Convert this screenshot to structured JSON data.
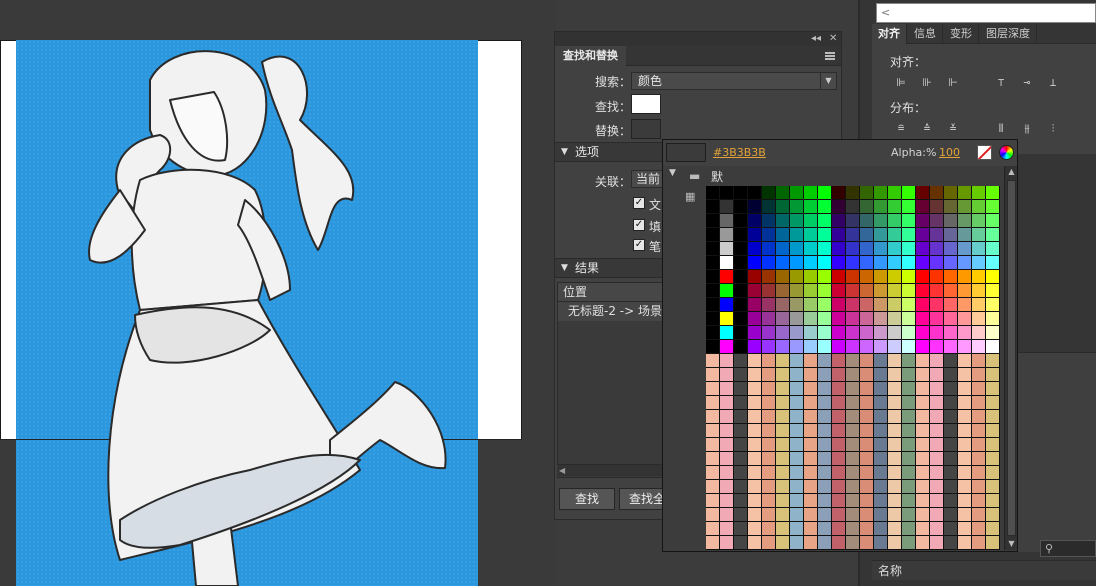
{
  "find_panel": {
    "collapse_glyph": "◂◂",
    "close_glyph": "✕",
    "title": "查找和替换",
    "search_label": "搜索：",
    "search_value": "颜色",
    "find_label": "查找：",
    "replace_label": "替换：",
    "find_color": "#FFFFFF",
    "replace_color": "#3B3B3B",
    "options_header": "选项",
    "related_label": "关联：",
    "related_value": "当前",
    "checks": [
      "文",
      "填",
      "笔"
    ],
    "results_header": "结果",
    "results_column": "位置",
    "results_row": "无标题-2 -> 场景",
    "find_button": "查找",
    "find_all_button": "查找全"
  },
  "right_panel": {
    "top_input_glyph": "<",
    "tabs": [
      "对齐",
      "信息",
      "变形",
      "图层深度"
    ],
    "align_label": "对齐：",
    "distribute_label": "分布：",
    "name_header": "名称"
  },
  "color_popup": {
    "hex": "#3B3B3B",
    "current_color": "#3B3B3B",
    "alpha_label": "Alpha:%",
    "alpha_value": "100",
    "palette_label": "默认色板",
    "no_color_icon": "no-color-icon",
    "wheel_icon": "color-wheel-icon"
  },
  "colors": {
    "stage_blue": "#2A97DE",
    "panel_bg": "#414141",
    "accent_orange": "#E2A33B"
  }
}
